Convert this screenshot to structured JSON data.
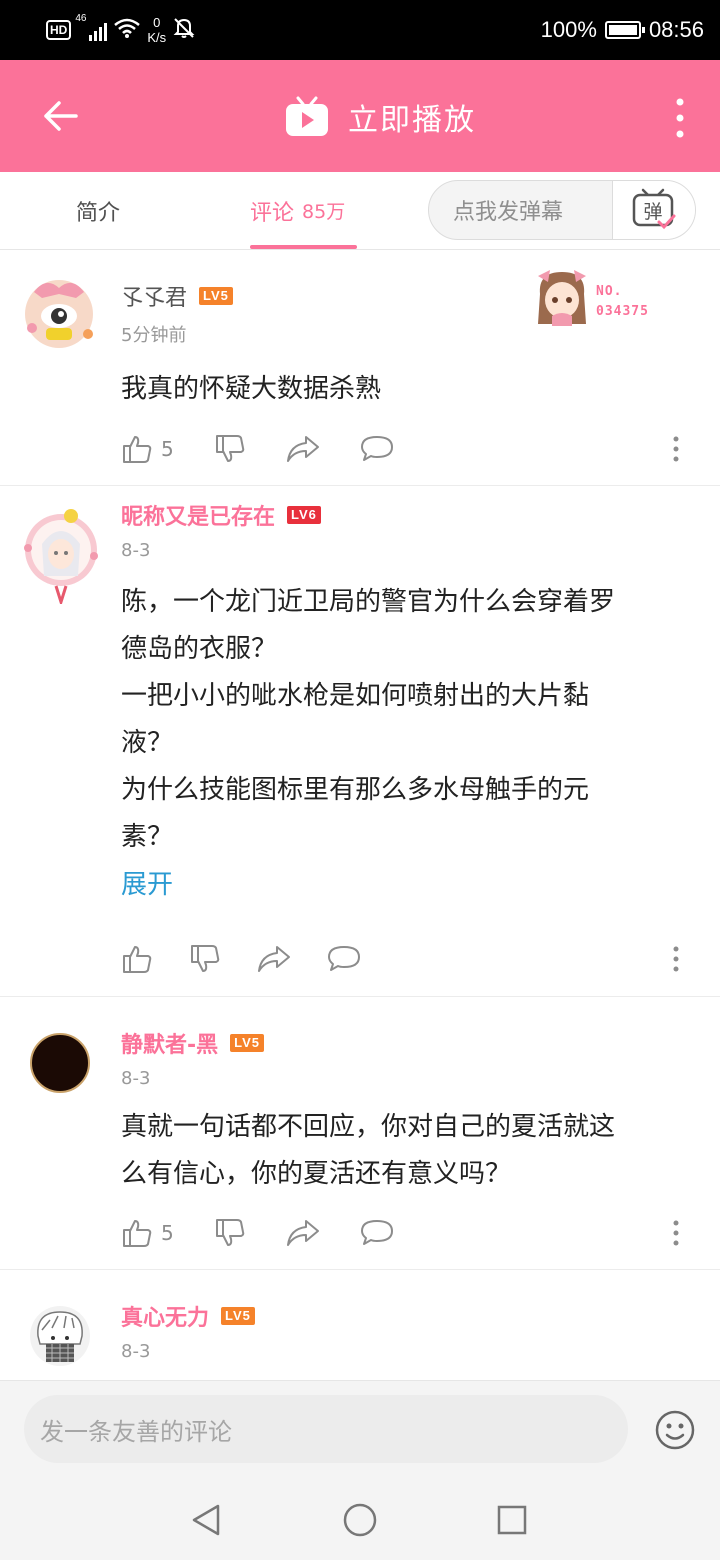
{
  "status_bar": {
    "hd_label": "HD",
    "network": "46",
    "speed_value": "0",
    "speed_unit": "K/s",
    "battery_percent": "100%",
    "time": "08:56",
    "battery_level": 1.0
  },
  "header": {
    "title": "立即播放",
    "back_icon": "arrow-left-icon",
    "play_icon": "tv-play-icon",
    "more_icon": "more-vertical-icon",
    "color": "#fb7299"
  },
  "tabs": {
    "intro_label": "简介",
    "comments_label": "评论",
    "comments_count": "85万",
    "danmaku_placeholder": "点我发弹幕",
    "danmaku_button": "弹",
    "active_color": "#fb7299"
  },
  "comments": [
    {
      "username": "孓孓君",
      "level": "LV5",
      "level_color": "#f5822a",
      "time": "5分钟前",
      "text": "我真的怀疑大数据杀熟",
      "likes": "5",
      "badge_label_1": "NO.",
      "badge_label_2": "034375"
    },
    {
      "username": "昵称又是已存在",
      "level": "LV6",
      "level_color": "#e8303c",
      "time": "8-3",
      "text_lines": [
        "陈，一个龙门近卫局的警官为什么会穿着罗",
        "德岛的衣服？",
        "一把小小的呲水枪是如何喷射出的大片黏",
        "液？",
        "为什么技能图标里有那么多水母触手的元",
        "素？"
      ],
      "expand_label": "展开"
    },
    {
      "username": "静默者-黑",
      "level": "LV5",
      "level_color": "#f5822a",
      "time": "8-3",
      "text_lines": [
        "真就一句话都不回应，你对自己的夏活就这",
        "么有信心，你的夏活还有意义吗？"
      ],
      "likes": "5"
    },
    {
      "username": "真心无力",
      "level": "LV5",
      "level_color": "#f5822a",
      "time": "8-3"
    }
  ],
  "composer": {
    "placeholder": "发一条友善的评论",
    "emoji_icon": "smiley-icon"
  },
  "nav": {
    "back_icon": "triangle-back-icon",
    "home_icon": "circle-home-icon",
    "recents_icon": "square-recents-icon"
  }
}
